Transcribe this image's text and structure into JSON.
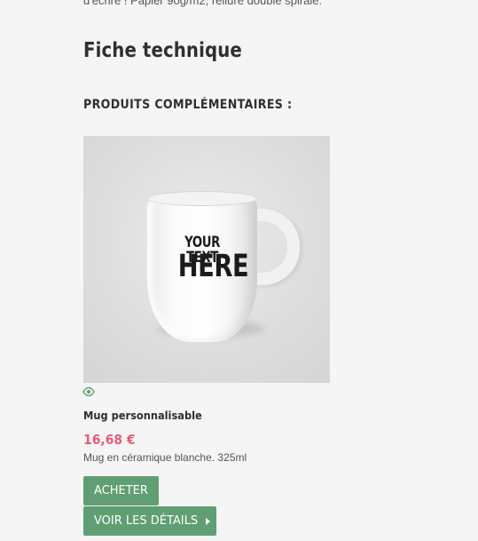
{
  "page": {
    "cut_text": "d'écrire ! Papier 90g/m2, reliure double spirale.",
    "section_title": "Fiche technique",
    "subtitle": "PRODUITS COMPLÉMENTAIRES :"
  },
  "product": {
    "image_text_top": "YOUR TEXT",
    "image_text_bottom": "HERE",
    "name": "Mug personnalisable",
    "price": "16,68 €",
    "description": "Mug en céramique blanche. 325ml",
    "buy_label": "ACHETER",
    "details_label": "VOIR LES DÉTAILS",
    "icons": {
      "quick_view": "eye-icon",
      "details_arrow": "caret-right-icon"
    }
  },
  "colors": {
    "button": "#5f9f73",
    "price": "#e55d78",
    "icon": "#5f9f73"
  }
}
